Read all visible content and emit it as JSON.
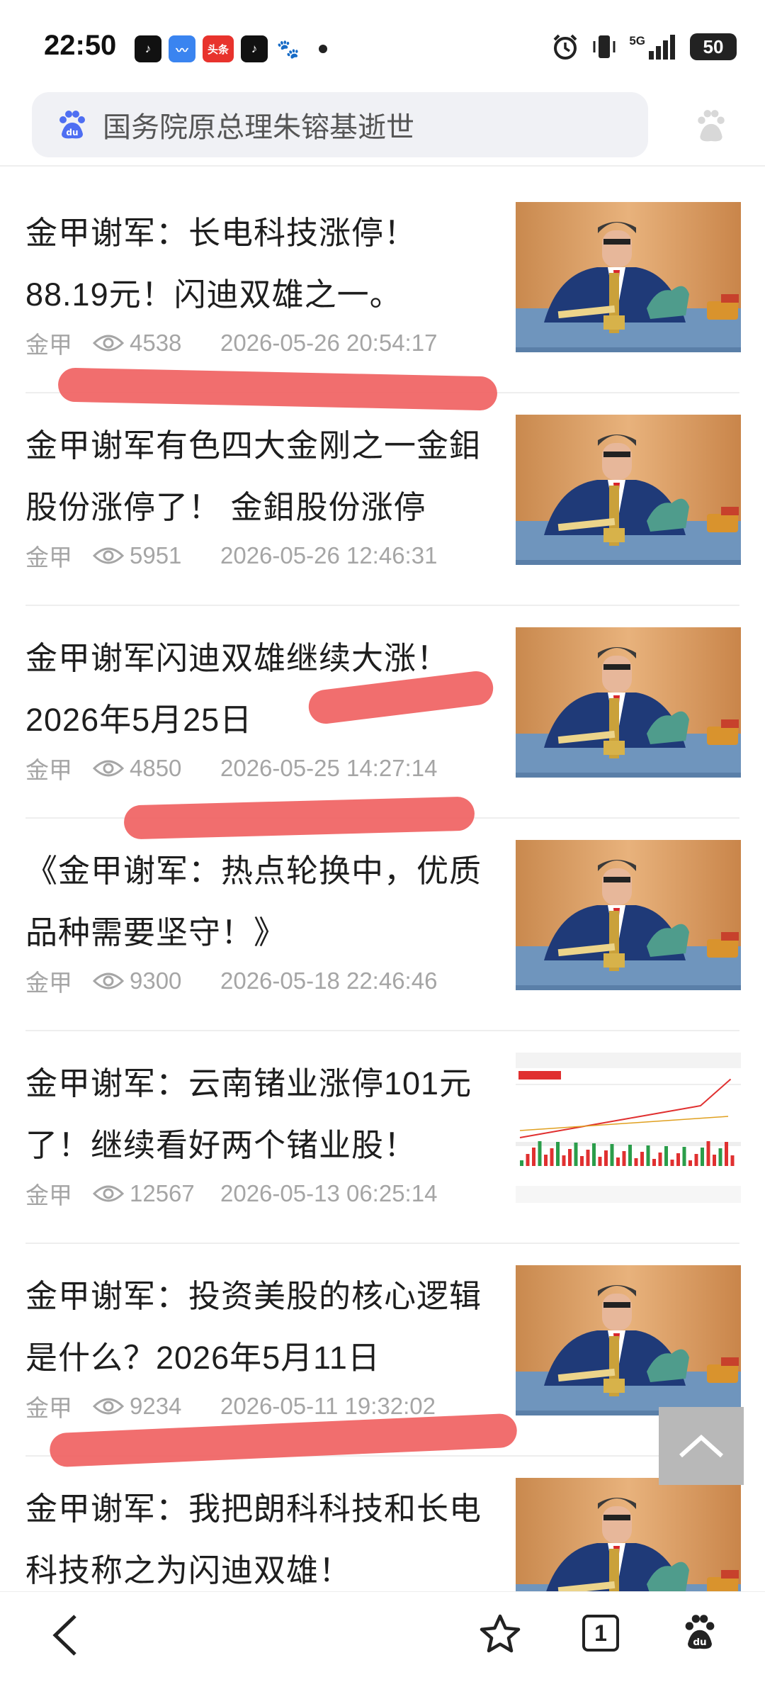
{
  "status_bar": {
    "time": "22:50",
    "network": "5G",
    "battery": "50"
  },
  "search": {
    "query": "国务院原总理朱镕基逝世"
  },
  "articles": [
    {
      "title": "金甲谢军：长电科技涨停！88.19元！闪迪双雄之一。",
      "source": "金甲",
      "views": "4538",
      "date": "2026-05-26 20:54:17",
      "thumb": "video-presenter"
    },
    {
      "title": "金甲谢军有色四大金刚之一金鉬股份涨停了！ 金鉬股份涨停",
      "source": "金甲",
      "views": "5951",
      "date": "2026-05-26 12:46:31",
      "thumb": "video-presenter"
    },
    {
      "title": "金甲谢军闪迪双雄继续大涨！2026年5月25日",
      "source": "金甲",
      "views": "4850",
      "date": "2026-05-25 14:27:14",
      "thumb": "video-presenter"
    },
    {
      "title": "《金甲谢军：热点轮换中，优质品种需要坚守！》",
      "source": "金甲",
      "views": "9300",
      "date": "2026-05-18 22:46:46",
      "thumb": "video-presenter"
    },
    {
      "title": "金甲谢军：云南锗业涨停101元了！继续看好两个锗业股！",
      "source": "金甲",
      "views": "12567",
      "date": "2026-05-13 06:25:14",
      "thumb": "stock-chart"
    },
    {
      "title": "金甲谢军：投资美股的核心逻辑是什么？2026年5月11日",
      "source": "金甲",
      "views": "9234",
      "date": "2026-05-11 19:32:02",
      "thumb": "video-presenter"
    },
    {
      "title": " 金甲谢军：我把朗科科技和长电科技称之为闪迪双雄！",
      "source": "",
      "views": "",
      "date": "",
      "thumb": "video-presenter"
    }
  ],
  "bottom_bar": {
    "tab_count": "1"
  },
  "colors": {
    "scribble": "#f06262",
    "meta": "#a5a5a5",
    "chart_up": "#e03030",
    "chart_down": "#2a9d4a"
  }
}
